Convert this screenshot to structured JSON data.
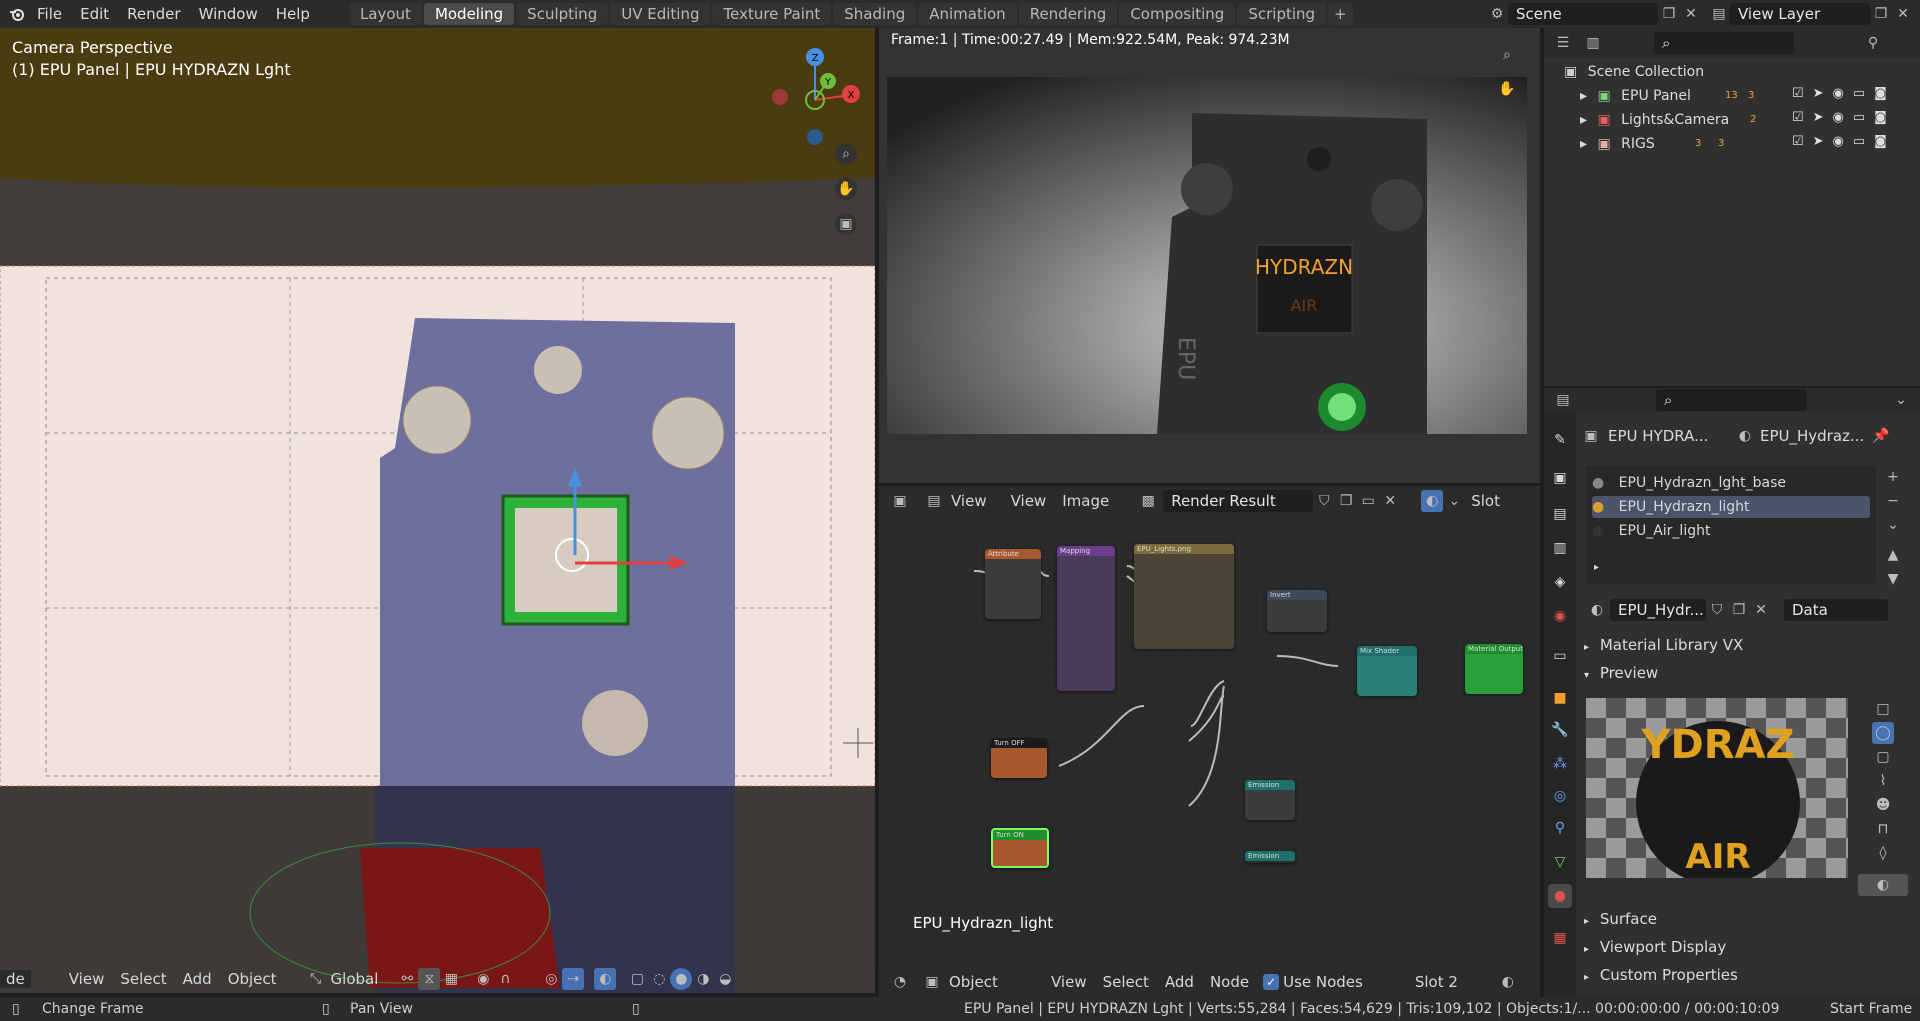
{
  "topbar": {
    "menus": [
      "File",
      "Edit",
      "Render",
      "Window",
      "Help"
    ],
    "workspaces": [
      "Layout",
      "Modeling",
      "Sculpting",
      "UV Editing",
      "Texture Paint",
      "Shading",
      "Animation",
      "Rendering",
      "Compositing",
      "Scripting"
    ],
    "active_workspace": "Modeling",
    "add_tab": "+",
    "scene": "Scene",
    "view_layer": "View Layer"
  },
  "viewport3d": {
    "title": "Camera Perspective",
    "subtitle": "(1) EPU Panel | EPU HYDRAZN Lght",
    "header": {
      "mode": "de",
      "menus": [
        "View",
        "Select",
        "Add",
        "Object"
      ],
      "transform": "Global"
    }
  },
  "render_view": {
    "info": "Frame:1 | Time:00:27.49 | Mem:922.54M, Peak: 974.23M",
    "panel_text_top": "HYDRAZN",
    "panel_text_bottom": "AIR",
    "side_text": "EPU",
    "header": {
      "view": "View",
      "view2": "View",
      "image": "Image",
      "image_name": "Render Result",
      "slot": "Slot"
    }
  },
  "node_editor": {
    "material_label": "EPU_Hydrazn_light",
    "header": {
      "object": "Object",
      "menus": [
        "View",
        "Select",
        "Add",
        "Node"
      ],
      "use_nodes_label": "Use Nodes",
      "use_nodes": true,
      "slot": "Slot 2"
    },
    "nodes": [
      {
        "title": "Attribute",
        "color": "#a8582e"
      },
      {
        "title": "Mapping",
        "color": "#6b3d8f"
      },
      {
        "title": "EPU_Lights.png",
        "color": "#7d6b3a"
      },
      {
        "title": "Invert",
        "color": "#3c4a5c"
      },
      {
        "title": "Mix Shader",
        "color": "#1f6f6a"
      },
      {
        "title": "Material Output",
        "color": "#1e8f2c"
      },
      {
        "title": "Turn OFF",
        "color": "#a8582e"
      },
      {
        "title": "Turn ON",
        "color": "#a8582e"
      },
      {
        "title": "Emission",
        "color": "#1f6f6a"
      },
      {
        "title": "Emission",
        "color": "#1f6f6a"
      }
    ]
  },
  "outliner": {
    "root": "Scene Collection",
    "items": [
      {
        "label": "EPU Panel",
        "badge1": "13",
        "badge2": "3"
      },
      {
        "label": "Lights&Camera",
        "badge1": "2",
        "badge2": ""
      },
      {
        "label": "RIGS",
        "badge1": "3",
        "badge2": "3"
      }
    ]
  },
  "properties": {
    "object_name": "EPU HYDRA...",
    "material_name": "EPU_Hydraz...",
    "material_slots": [
      "EPU_Hydrazn_lght_base",
      "EPU_Hydrazn_light",
      "EPU_Air_light"
    ],
    "selected_slot": 1,
    "material_field": "EPU_Hydr...",
    "link": "Data",
    "sections": [
      "Material Library VX",
      "Preview",
      "Surface",
      "Viewport Display",
      "Custom Properties"
    ],
    "preview_text_top": "YDRAZ",
    "preview_text_bottom": "AIR"
  },
  "statusbar": {
    "left1": "Change Frame",
    "left2": "Pan View",
    "right": "EPU Panel | EPU HYDRAZN Lght | Verts:55,284 | Faces:54,629 | Tris:109,102 | Objects:1/...  00:00:00:00 / 00:00:10:09",
    "far_right": "Start Frame"
  },
  "colors": {
    "accent": "#4772b3",
    "viewport_bg": "#3d3a38",
    "sky": "#4a3c10",
    "model": "#6f6f9e"
  }
}
